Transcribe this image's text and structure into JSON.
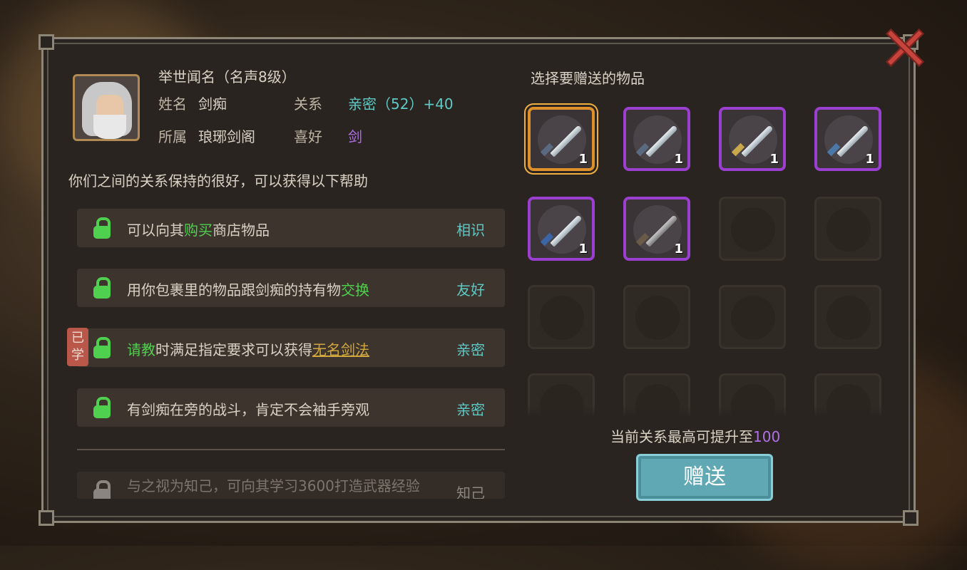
{
  "npc": {
    "title": "举世闻名（名声8级）",
    "name_label": "姓名",
    "name": "剑痴",
    "relation_label": "关系",
    "relation_value": "亲密（52）+40",
    "faction_label": "所属",
    "faction": "琅琊剑阁",
    "likes_label": "喜好",
    "likes": "剑"
  },
  "relation_note": "你们之间的关系保持的很好，可以获得以下帮助",
  "benefits": [
    {
      "pre": "可以向其",
      "hl": "购买",
      "post": "商店物品",
      "level": "相识",
      "level_color": "#5fc9c6",
      "unlocked": true
    },
    {
      "pre": "用你包裹里的物品跟剑痴的持有物",
      "hl": "交换",
      "post": "",
      "level": "友好",
      "level_color": "#5fc9c6",
      "unlocked": true
    },
    {
      "pre": "",
      "hl": "请教",
      "post": "时满足指定要求可以获得",
      "link": "无名剑法",
      "level": "亲密",
      "level_color": "#5fc9c6",
      "unlocked": true,
      "badge": "已学"
    },
    {
      "pre": "有剑痴在旁的战斗，肯定不会袖手旁观",
      "hl": "",
      "post": "",
      "level": "亲密",
      "level_color": "#5fc9c6",
      "unlocked": true
    },
    {
      "pre": "与之视为知己，可向其学习3600打造武器经验",
      "hl": "",
      "post": "",
      "level": "知己",
      "level_color": "#8a8580",
      "unlocked": false
    }
  ],
  "gift": {
    "header": "选择要赠送的物品",
    "items": [
      {
        "icon": "sword-icon",
        "count": "1",
        "selected": true
      },
      {
        "icon": "sword-icon",
        "count": "1"
      },
      {
        "icon": "sword-icon",
        "count": "1"
      },
      {
        "icon": "sword-icon",
        "count": "1"
      },
      {
        "icon": "sword-icon",
        "count": "1"
      },
      {
        "icon": "sword-icon",
        "count": "1"
      }
    ],
    "max_prefix": "当前关系最高可提升至",
    "max_value": "100",
    "button_label": "赠送"
  },
  "colors": {
    "rarity_purple": "#9b3fd0",
    "selected_orange": "#e0902a",
    "accent_green": "#4fd14f",
    "accent_cyan": "#5fc9c6"
  }
}
